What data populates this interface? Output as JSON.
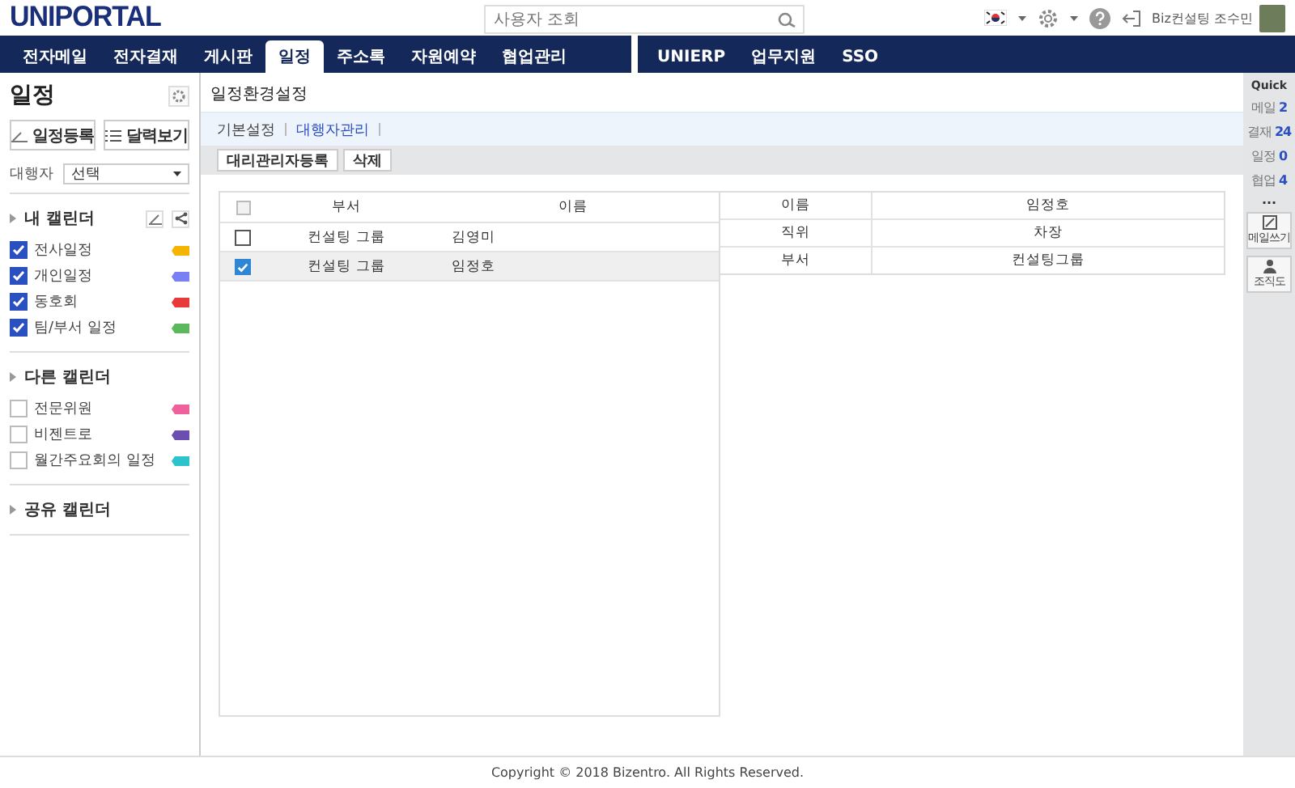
{
  "logo": "UNIPORTAL",
  "search": {
    "placeholder": "사용자 조회"
  },
  "user": {
    "name": "Biz컨설팅 조수민"
  },
  "nav_left": [
    {
      "label": "전자메일",
      "selected": false
    },
    {
      "label": "전자결재",
      "selected": false
    },
    {
      "label": "게시판",
      "selected": false
    },
    {
      "label": "일정",
      "selected": true
    },
    {
      "label": "주소록",
      "selected": false
    },
    {
      "label": "자원예약",
      "selected": false
    },
    {
      "label": "협업관리",
      "selected": false
    }
  ],
  "nav_right": [
    {
      "label": "UNIERP",
      "selected": false
    },
    {
      "label": "업무지원",
      "selected": false
    },
    {
      "label": "SSO",
      "selected": false
    }
  ],
  "sidebar": {
    "title": "일정",
    "buttons": [
      "일정등록",
      "달력보기"
    ],
    "delegate_label": "대행자",
    "delegate_value": "선택",
    "groups": [
      {
        "title": "내 캘린더",
        "tools": true,
        "items": [
          {
            "label": "전사일정",
            "checked": true,
            "color": "#f5b400"
          },
          {
            "label": "개인일정",
            "checked": true,
            "color": "#7b7ff5"
          },
          {
            "label": "동호회",
            "checked": true,
            "color": "#e83a3a"
          },
          {
            "label": "팀/부서 일정",
            "checked": true,
            "color": "#5cb85c"
          }
        ]
      },
      {
        "title": "다른 캘린더",
        "tools": false,
        "items": [
          {
            "label": "전문위원",
            "checked": false,
            "color": "#f0609a"
          },
          {
            "label": "비젠트로",
            "checked": false,
            "color": "#6a4fb0"
          },
          {
            "label": "월간주요회의 일정",
            "checked": false,
            "color": "#2cc3cc"
          }
        ]
      },
      {
        "title": "공유 캘린더",
        "tools": false
      }
    ]
  },
  "main": {
    "title": "일정환경설정",
    "subtabs": [
      {
        "label": "기본설정",
        "selected": false
      },
      {
        "label": "대행자관리",
        "selected": true
      }
    ],
    "actions": [
      "대리관리자등록",
      "삭제"
    ],
    "list": {
      "all_checked": false,
      "columns": [
        "부서",
        "이름"
      ],
      "rows": [
        {
          "dept": "컨설팅 그룹",
          "name": "김영미",
          "checked": false,
          "selected": false
        },
        {
          "dept": "컨설팅 그룹",
          "name": "임정호",
          "checked": true,
          "selected": true
        }
      ]
    },
    "detail": [
      {
        "label": "이름",
        "value": "임정호"
      },
      {
        "label": "직위",
        "value": "차장"
      },
      {
        "label": "부서",
        "value": "컨설팅그룹"
      }
    ]
  },
  "quick": {
    "title": "Quick",
    "counts": [
      {
        "label": "메일",
        "count": "2"
      },
      {
        "label": "결재",
        "count": "24"
      },
      {
        "label": "일정",
        "count": "0"
      },
      {
        "label": "협업",
        "count": "4"
      }
    ],
    "more": "...",
    "buttons": [
      {
        "kind": "write",
        "label": "메일쓰기"
      },
      {
        "kind": "org",
        "label": "조직도"
      }
    ]
  },
  "footer": "Copyright © 2018 Bizentro. All Rights Reserved."
}
